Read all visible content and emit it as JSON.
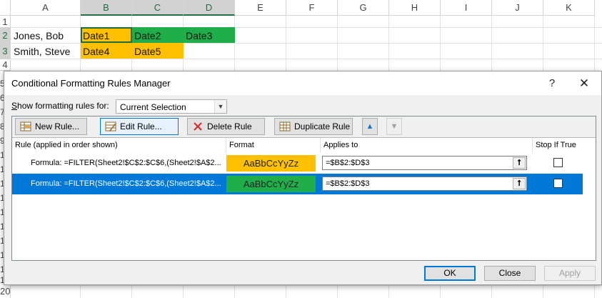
{
  "sheet": {
    "columns": [
      "A",
      "B",
      "C",
      "D",
      "E",
      "F",
      "G",
      "H",
      "I",
      "J",
      "K"
    ],
    "rows": [
      "1",
      "2",
      "3",
      "4",
      "5",
      "6",
      "7",
      "8",
      "9",
      "10",
      "11",
      "12",
      "13",
      "14",
      "15",
      "16",
      "17",
      "18",
      "19",
      "20"
    ],
    "cells": {
      "A2": "Jones, Bob",
      "A3": "Smith, Steve",
      "B2": "Date1",
      "C2": "Date2",
      "D2": "Date3",
      "B3": "Date4",
      "C3": "Date5"
    },
    "colors": {
      "orange": "#ffc000",
      "green": "#1fae4a",
      "header_accent": "#217346"
    }
  },
  "dialog": {
    "title": "Conditional Formatting Rules Manager",
    "help_label": "?",
    "close_label": "✕",
    "show_label_prefix": "S",
    "show_label_rest": "how formatting rules for:",
    "show_value": "Current Selection",
    "toolbar": {
      "new_rule": "New Rule...",
      "edit_rule": "Edit Rule...",
      "delete_rule": "Delete Rule",
      "duplicate_rule": "Duplicate Rule",
      "move_up_icon": "arrow-up-icon",
      "move_down_icon": "arrow-down-icon"
    },
    "headers": {
      "rule": "Rule (applied in order shown)",
      "format": "Format",
      "applies_to": "Applies to",
      "stop_if_true": "Stop If True"
    },
    "rules": [
      {
        "formula": "Formula: =FILTER(Sheet2!$C$2:$C$6,(Sheet2!$A$2...",
        "preview": "AaBbCcYyZz",
        "preview_color": "#ffc000",
        "applies_to": "=$B$2:$D$3",
        "stop_if_true": false,
        "selected": false
      },
      {
        "formula": "Formula: =FILTER(Sheet2!$C$2:$C$6,(Sheet2!$A$2...",
        "preview": "AaBbCcYyZz",
        "preview_color": "#1fae4a",
        "applies_to": "=$B$2:$D$3",
        "stop_if_true": false,
        "selected": true
      }
    ],
    "buttons": {
      "ok": "OK",
      "close": "Close",
      "apply": "Apply"
    },
    "accent": "#0078d7"
  }
}
